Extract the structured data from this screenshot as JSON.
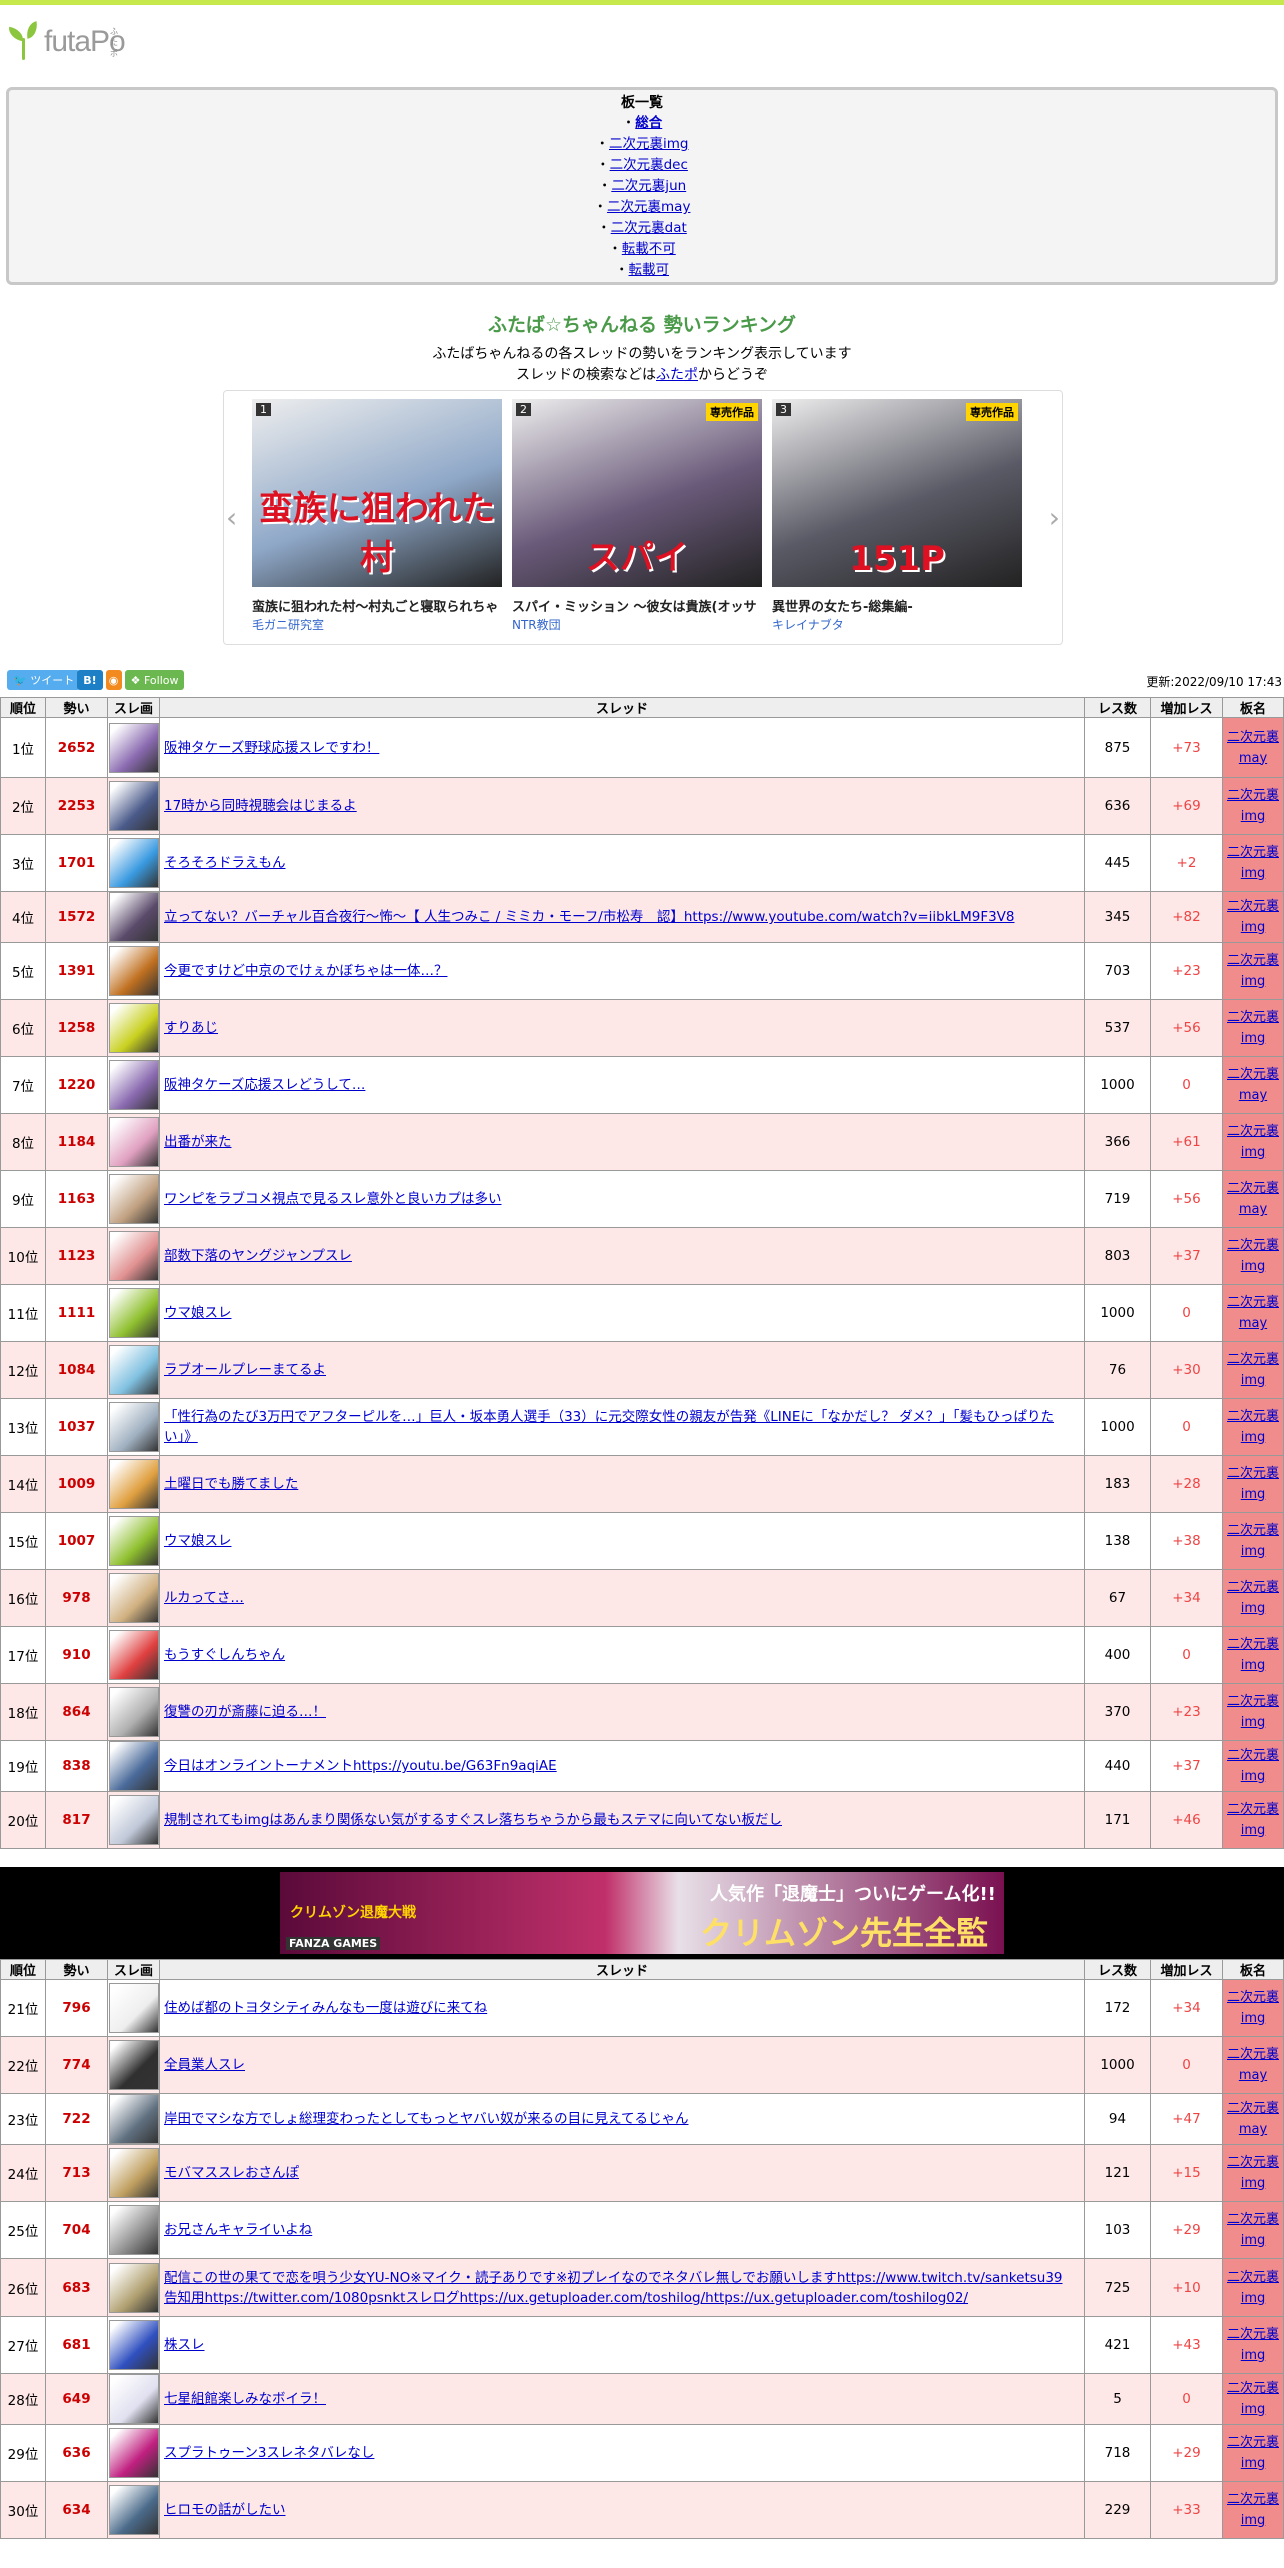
{
  "site": {
    "name": "futaPo",
    "name_kana": "ふたポ"
  },
  "board_list": {
    "heading": "板一覧",
    "items": [
      "総合",
      "二次元裏img",
      "二次元裏dec",
      "二次元裏jun",
      "二次元裏may",
      "二次元裏dat",
      "転載不可",
      "転載可"
    ]
  },
  "ranking": {
    "title": "ふたば☆ちゃんねる 勢いランキング",
    "desc1": "ふたばちゃんねるの各スレッドの勢いをランキング表示しています",
    "desc2_pre": "スレッドの検索などは",
    "desc2_link": "ふたポ",
    "desc2_post": "からどうぞ"
  },
  "carousel": {
    "items": [
      {
        "rank": "1",
        "title": "蛮族に狙われた村～村丸ごと寝取られちゃ",
        "maker": "毛ガニ研究室",
        "badge": "",
        "art_text": "蛮族に狙われた村",
        "color": "#8fa8c8"
      },
      {
        "rank": "2",
        "title": "スパイ・ミッション ～彼女は貴族(オッサ",
        "maker": "NTR教団",
        "badge": "専売作品",
        "art_text": "スパイ",
        "color": "#6a5a7a"
      },
      {
        "rank": "3",
        "title": "異世界の女たち-総集編-",
        "maker": "キレイナブタ",
        "badge": "専売作品",
        "art_text": "151P",
        "color": "#5a5a66"
      }
    ]
  },
  "share": {
    "tweet": "ツイート",
    "hatena": "B!",
    "follow": "Follow",
    "updated": "更新:2022/09/10 17:43"
  },
  "table_headers": {
    "rank": "順位",
    "momentum": "勢い",
    "thumb": "スレ画",
    "thread": "スレッド",
    "res": "レス数",
    "inc": "増加レス",
    "board": "板名"
  },
  "rows": [
    {
      "rank": "1位",
      "mom": "2652",
      "title": "阪神タケーズ野球応援スレですわ！",
      "res": "875",
      "inc": "+73",
      "board": "二次元裏may",
      "c": "#8a6ab0"
    },
    {
      "rank": "2位",
      "mom": "2253",
      "title": "17時から同時視聴会はじまるよ",
      "res": "636",
      "inc": "+69",
      "board": "二次元裏img",
      "c": "#4a5a8a"
    },
    {
      "rank": "3位",
      "mom": "1701",
      "title": "そろそろドラえもん",
      "res": "445",
      "inc": "+2",
      "board": "二次元裏img",
      "c": "#3a9ae0"
    },
    {
      "rank": "4位",
      "mom": "1572",
      "title": "立ってない？バーチャル百合夜行〜怖〜【 人生つみこ / ミミカ・モーフ/市松寿　認】https://www.youtube.com/watch?v=iibkLM9F3V8",
      "res": "345",
      "inc": "+82",
      "board": "二次元裏img",
      "c": "#5a4a6a"
    },
    {
      "rank": "5位",
      "mom": "1391",
      "title": "今更ですけど中京のでけぇかぼちゃは一体…？",
      "res": "703",
      "inc": "+23",
      "board": "二次元裏img",
      "c": "#c07020"
    },
    {
      "rank": "6位",
      "mom": "1258",
      "title": "すりあじ",
      "res": "537",
      "inc": "+56",
      "board": "二次元裏img",
      "c": "#c8d020"
    },
    {
      "rank": "7位",
      "mom": "1220",
      "title": "阪神タケーズ応援スレどうして…",
      "res": "1000",
      "inc": "0",
      "board": "二次元裏may",
      "c": "#8a6ab0"
    },
    {
      "rank": "8位",
      "mom": "1184",
      "title": "出番が来た",
      "res": "366",
      "inc": "+61",
      "board": "二次元裏img",
      "c": "#e0a0c0"
    },
    {
      "rank": "9位",
      "mom": "1163",
      "title": "ワンピをラブコメ視点で見るスレ意外と良いカプは多い",
      "res": "719",
      "inc": "+56",
      "board": "二次元裏may",
      "c": "#c0a080"
    },
    {
      "rank": "10位",
      "mom": "1123",
      "title": "部数下落のヤングジャンプスレ",
      "res": "803",
      "inc": "+37",
      "board": "二次元裏img",
      "c": "#e09090"
    },
    {
      "rank": "11位",
      "mom": "1111",
      "title": "ウマ娘スレ",
      "res": "1000",
      "inc": "0",
      "board": "二次元裏may",
      "c": "#90c030"
    },
    {
      "rank": "12位",
      "mom": "1084",
      "title": "ラブオールプレーまてるよ",
      "res": "76",
      "inc": "+30",
      "board": "二次元裏img",
      "c": "#80c0e0"
    },
    {
      "rank": "13位",
      "mom": "1037",
      "title": "「性行為のたび3万円でアフターピルを…」巨人・坂本勇人選手（33）に元交際女性の親友が告発《LINEに「なかだし？ ダメ？」「髪もひっぱりたい」》",
      "res": "1000",
      "inc": "0",
      "board": "二次元裏img",
      "c": "#a0b0c0"
    },
    {
      "rank": "14位",
      "mom": "1009",
      "title": "土曜日でも勝てました",
      "res": "183",
      "inc": "+28",
      "board": "二次元裏img",
      "c": "#e0a040"
    },
    {
      "rank": "15位",
      "mom": "1007",
      "title": "ウマ娘スレ",
      "res": "138",
      "inc": "+38",
      "board": "二次元裏img",
      "c": "#90c030"
    },
    {
      "rank": "16位",
      "mom": "978",
      "title": "ルカってさ…",
      "res": "67",
      "inc": "+34",
      "board": "二次元裏img",
      "c": "#d0b080"
    },
    {
      "rank": "17位",
      "mom": "910",
      "title": "もうすぐしんちゃん",
      "res": "400",
      "inc": "0",
      "board": "二次元裏img",
      "c": "#e04040"
    },
    {
      "rank": "18位",
      "mom": "864",
      "title": "復讐の刃が斎藤に迫る…！",
      "res": "370",
      "inc": "+23",
      "board": "二次元裏img",
      "c": "#b0b0b0"
    },
    {
      "rank": "19位",
      "mom": "838",
      "title": "今日はオンライントーナメントhttps://youtu.be/G63Fn9aqiAE",
      "res": "440",
      "inc": "+37",
      "board": "二次元裏img",
      "c": "#4a6a9a"
    },
    {
      "rank": "20位",
      "mom": "817",
      "title": "規制されてもimgはあんまり関係ない気がするすぐスレ落ちちゃうから最もステマに向いてない板だし",
      "res": "171",
      "inc": "+46",
      "board": "二次元裏img",
      "c": "#c0c8d8"
    },
    {
      "rank": "21位",
      "mom": "796",
      "title": "住めば都のトヨタシティみんなも一度は遊びに来てね",
      "res": "172",
      "inc": "+34",
      "board": "二次元裏img",
      "c": "#eeeeee"
    },
    {
      "rank": "22位",
      "mom": "774",
      "title": "全員業人スレ",
      "res": "1000",
      "inc": "0",
      "board": "二次元裏may",
      "c": "#303030"
    },
    {
      "rank": "23位",
      "mom": "722",
      "title": "岸田でマシな方でしょ総理変わったとしてもっとヤバい奴が来るの目に見えてるじゃん",
      "res": "94",
      "inc": "+47",
      "board": "二次元裏may",
      "c": "#607080"
    },
    {
      "rank": "24位",
      "mom": "713",
      "title": "モバマススレおさんぽ",
      "res": "121",
      "inc": "+15",
      "board": "二次元裏img",
      "c": "#c0a060"
    },
    {
      "rank": "25位",
      "mom": "704",
      "title": "お兄さんキャライいよね",
      "res": "103",
      "inc": "+29",
      "board": "二次元裏img",
      "c": "#909090"
    },
    {
      "rank": "26位",
      "mom": "683",
      "title": "配信この世の果てで恋を唄う少女YU-NO※マイク・読子ありです※初プレイなのでネタバレ無しでお願いしますhttps://www.twitch.tv/sanketsu39 告知用https://twitter.com/1080psnktスレログhttps://ux.getuploader.com/toshilog/https://ux.getuploader.com/toshilog02/",
      "res": "725",
      "inc": "+10",
      "board": "二次元裏img",
      "c": "#b0a070"
    },
    {
      "rank": "27位",
      "mom": "681",
      "title": "株スレ",
      "res": "421",
      "inc": "+43",
      "board": "二次元裏img",
      "c": "#3050c0"
    },
    {
      "rank": "28位",
      "mom": "649",
      "title": "七星組館楽しみなボイラ！",
      "res": "5",
      "inc": "0",
      "board": "二次元裏img",
      "c": "#e0e0f0"
    },
    {
      "rank": "29位",
      "mom": "636",
      "title": "スプラトゥーン3スレネタバレなし",
      "res": "718",
      "inc": "+29",
      "board": "二次元裏img",
      "c": "#c02080"
    },
    {
      "rank": "30位",
      "mom": "634",
      "title": "ヒロモの話がしたい",
      "res": "229",
      "inc": "+33",
      "board": "二次元裏img",
      "c": "#4a6a8a"
    }
  ],
  "ad_banner": {
    "brand": "FANZA GAMES",
    "headline": "人気作「退魔士」ついにゲーム化!!",
    "subline": "クリムゾン先生全監修",
    "left": "クリムゾン退魔大戦"
  }
}
